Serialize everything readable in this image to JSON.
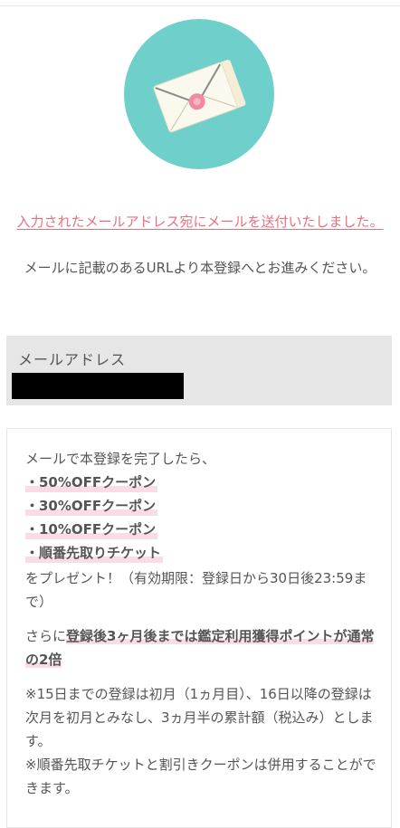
{
  "header": {
    "icon": "envelope-icon"
  },
  "colors": {
    "circle": "#6fcfcb",
    "alert_text": "#e8707c",
    "highlight": "#fadce4",
    "box_bg": "#e6e6e6"
  },
  "messages": {
    "sent": "入力されたメールアドレス宛にメールを送付いたしました。",
    "proceed": "メールに記載のあるURLより本登録へとお進みください。"
  },
  "email": {
    "label": "メールアドレス",
    "value": "████████████"
  },
  "benefits": {
    "intro": "メールで本登録を完了したら、",
    "perks": [
      "・50%OFFクーポン",
      "・30%OFFクーポン",
      "・10%OFFクーポン",
      "・順番先取りチケット"
    ],
    "present": "をプレゼント！（有効期限：登録日から30日後23:59まで）",
    "double_prefix": "さらに",
    "double_highlight": "登録後3ヶ月後までは鑑定利用獲得ポイントが通常の2倍",
    "note_1": "※15日までの登録は初月（1ヵ月目）、16日以降の登録は次月を初月とみなし、3ヵ月半の累計額（税込み）とします。",
    "note_2": "※順番先取チケットと割引きクーポンは併用することができます。"
  }
}
